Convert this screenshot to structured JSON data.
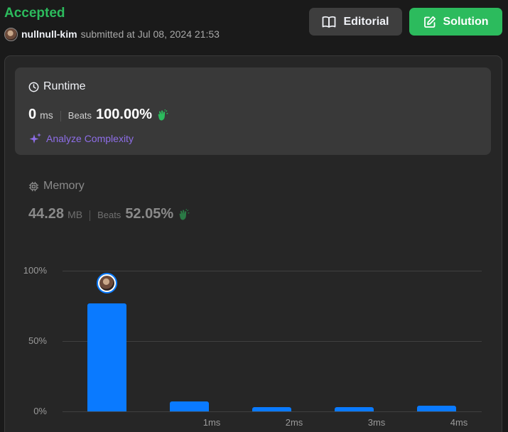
{
  "submission": {
    "status": "Accepted",
    "username": "nullnull-kim",
    "submitted_text": "submitted at Jul 08, 2024 21:53"
  },
  "actions": {
    "editorial_label": "Editorial",
    "solution_label": "Solution"
  },
  "runtime": {
    "title": "Runtime",
    "value": "0",
    "unit": "ms",
    "beats_label": "Beats",
    "beats_value": "100.00%",
    "analyze_label": "Analyze Complexity"
  },
  "memory": {
    "title": "Memory",
    "value": "44.28",
    "unit": "MB",
    "beats_label": "Beats",
    "beats_value": "52.05%"
  },
  "colors": {
    "accepted": "#2cbb5d",
    "bar": "#0a7aff",
    "analyze": "#8e6ee8",
    "clap": "#2cbb5d"
  },
  "icons": {
    "editorial": "book-open-icon",
    "solution": "edit-icon",
    "runtime": "clock-icon",
    "memory": "chip-icon",
    "analyze": "sparkle-icon",
    "beats": "clap-icon"
  },
  "chart_data": {
    "type": "bar",
    "categories": [
      "",
      "1ms",
      "2ms",
      "3ms",
      "4ms"
    ],
    "values": [
      77,
      7,
      3,
      3,
      4
    ],
    "y_ticks": [
      "0%",
      "50%",
      "100%"
    ],
    "y_tick_values": [
      0,
      50,
      100
    ],
    "ylim": [
      0,
      100
    ],
    "highlight_index": 0
  }
}
